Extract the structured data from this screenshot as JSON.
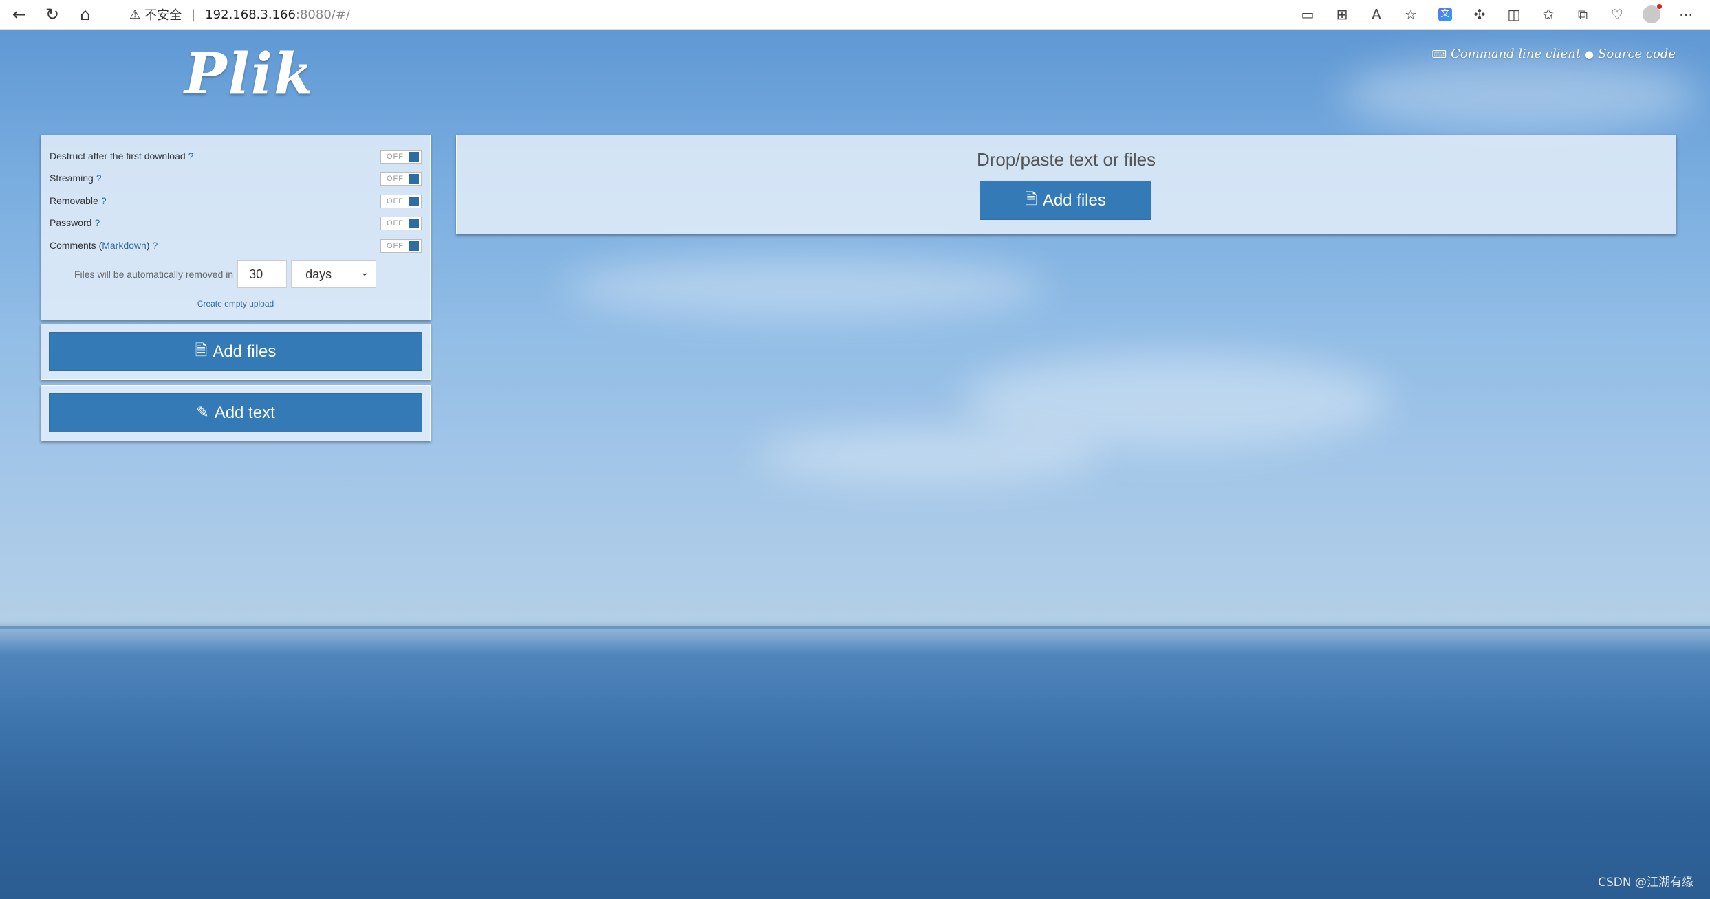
{
  "browser": {
    "security_label": "不安全",
    "address_host": "192.168.3.166",
    "address_path": ":8080/#/",
    "icons": [
      "back-icon",
      "refresh-icon",
      "home-icon",
      "screen-cast-icon",
      "apps-icon",
      "read-aloud-icon",
      "favorite-icon",
      "extension-icon",
      "split-screen-icon",
      "favorites-bar-icon",
      "collections-icon",
      "performance-icon",
      "profile-icon",
      "more-icon"
    ]
  },
  "header": {
    "logo": "Plik",
    "cli_link": "Command line client",
    "source_link": "Source code"
  },
  "settings": {
    "options": [
      {
        "label": "Destruct after the first download",
        "help": "?",
        "state": "OFF"
      },
      {
        "label": "Streaming",
        "help": "?",
        "state": "OFF"
      },
      {
        "label": "Removable",
        "help": "?",
        "state": "OFF"
      },
      {
        "label": "Password",
        "help": "?",
        "state": "OFF"
      },
      {
        "label": "Comments (",
        "link": "Markdown",
        "suffix": ")",
        "help": "?",
        "state": "OFF"
      }
    ],
    "ttl_label": "Files will be automatically removed in",
    "ttl_value": "30",
    "ttl_unit": "days",
    "create_empty": "Create empty upload"
  },
  "buttons": {
    "add_files": "Add files",
    "add_text": "Add text"
  },
  "dropzone": {
    "title": "Drop/paste text or files",
    "button": "Add files"
  },
  "watermark": "CSDN @江湖有缘",
  "colors": {
    "primary": "#337ab7",
    "link": "#2e6da4"
  }
}
